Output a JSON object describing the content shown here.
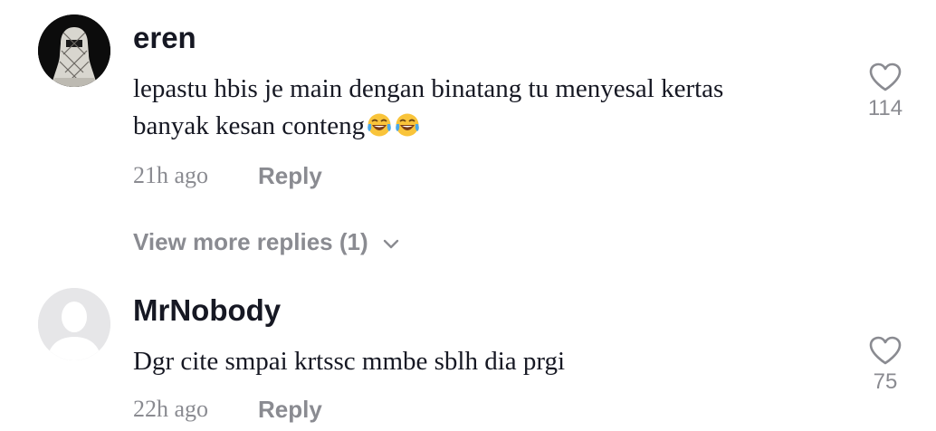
{
  "comments": [
    {
      "username": "eren",
      "avatar_icon": "keffiyeh-avatar-icon",
      "text_line1": "lepastu hbis je main dengan binatang tu menyesal kertas",
      "text_line2": "banyak kesan conteng",
      "emoji": [
        "face-with-tears-of-joy-icon",
        "face-with-tears-of-joy-icon"
      ],
      "time": "21h ago",
      "reply_label": "Reply",
      "like_count": "114",
      "view_more_label": "View more replies (1)"
    },
    {
      "username": "MrNobody",
      "avatar_icon": "default-avatar-icon",
      "text": "Dgr cite smpai krtssc mmbe sblh dia prgi",
      "time": "22h ago",
      "reply_label": "Reply",
      "like_count": "75"
    }
  ],
  "colors": {
    "primary_text": "#161823",
    "secondary_text": "#8a8b91",
    "icon_gray": "#8a8b91"
  }
}
